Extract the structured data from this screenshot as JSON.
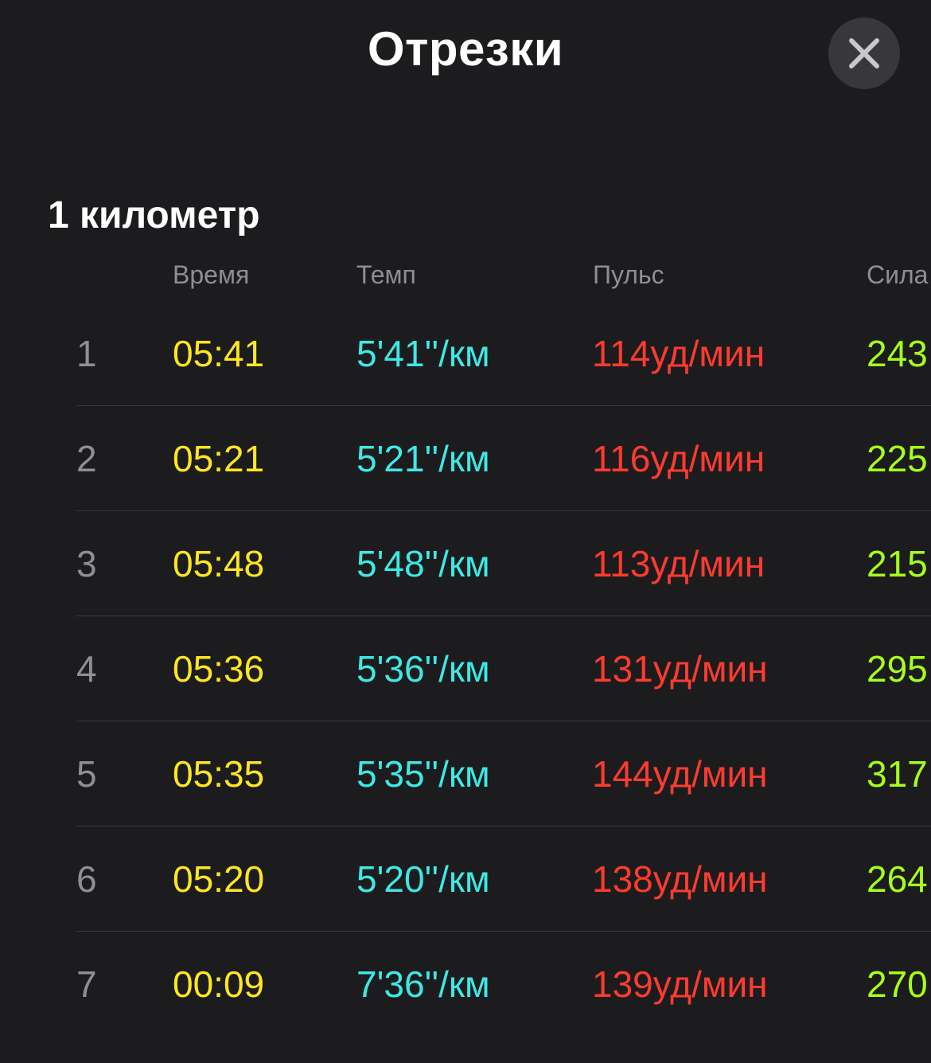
{
  "header": {
    "title": "Отрезки",
    "close_icon": "close-icon"
  },
  "section": {
    "title": "1 километр"
  },
  "columns": {
    "time": "Время",
    "pace": "Темп",
    "heart_rate": "Пульс",
    "power": "Сила"
  },
  "colors": {
    "background": "#1c1c1e",
    "time": "#ffe620",
    "pace": "#3ee8e4",
    "heart_rate": "#ff3b2f",
    "power": "#a6ff1a",
    "muted": "#8e8e93"
  },
  "rows": [
    {
      "index": "1",
      "time": "05:41",
      "pace": "5'41''/км",
      "hr": "114уд/мин",
      "power": "243"
    },
    {
      "index": "2",
      "time": "05:21",
      "pace": "5'21''/км",
      "hr": "116уд/мин",
      "power": "225"
    },
    {
      "index": "3",
      "time": "05:48",
      "pace": "5'48''/км",
      "hr": "113уд/мин",
      "power": "215"
    },
    {
      "index": "4",
      "time": "05:36",
      "pace": "5'36''/км",
      "hr": "131уд/мин",
      "power": "295"
    },
    {
      "index": "5",
      "time": "05:35",
      "pace": "5'35''/км",
      "hr": "144уд/мин",
      "power": "317"
    },
    {
      "index": "6",
      "time": "05:20",
      "pace": "5'20''/км",
      "hr": "138уд/мин",
      "power": "264"
    },
    {
      "index": "7",
      "time": "00:09",
      "pace": "7'36''/км",
      "hr": "139уд/мин",
      "power": "270"
    }
  ]
}
